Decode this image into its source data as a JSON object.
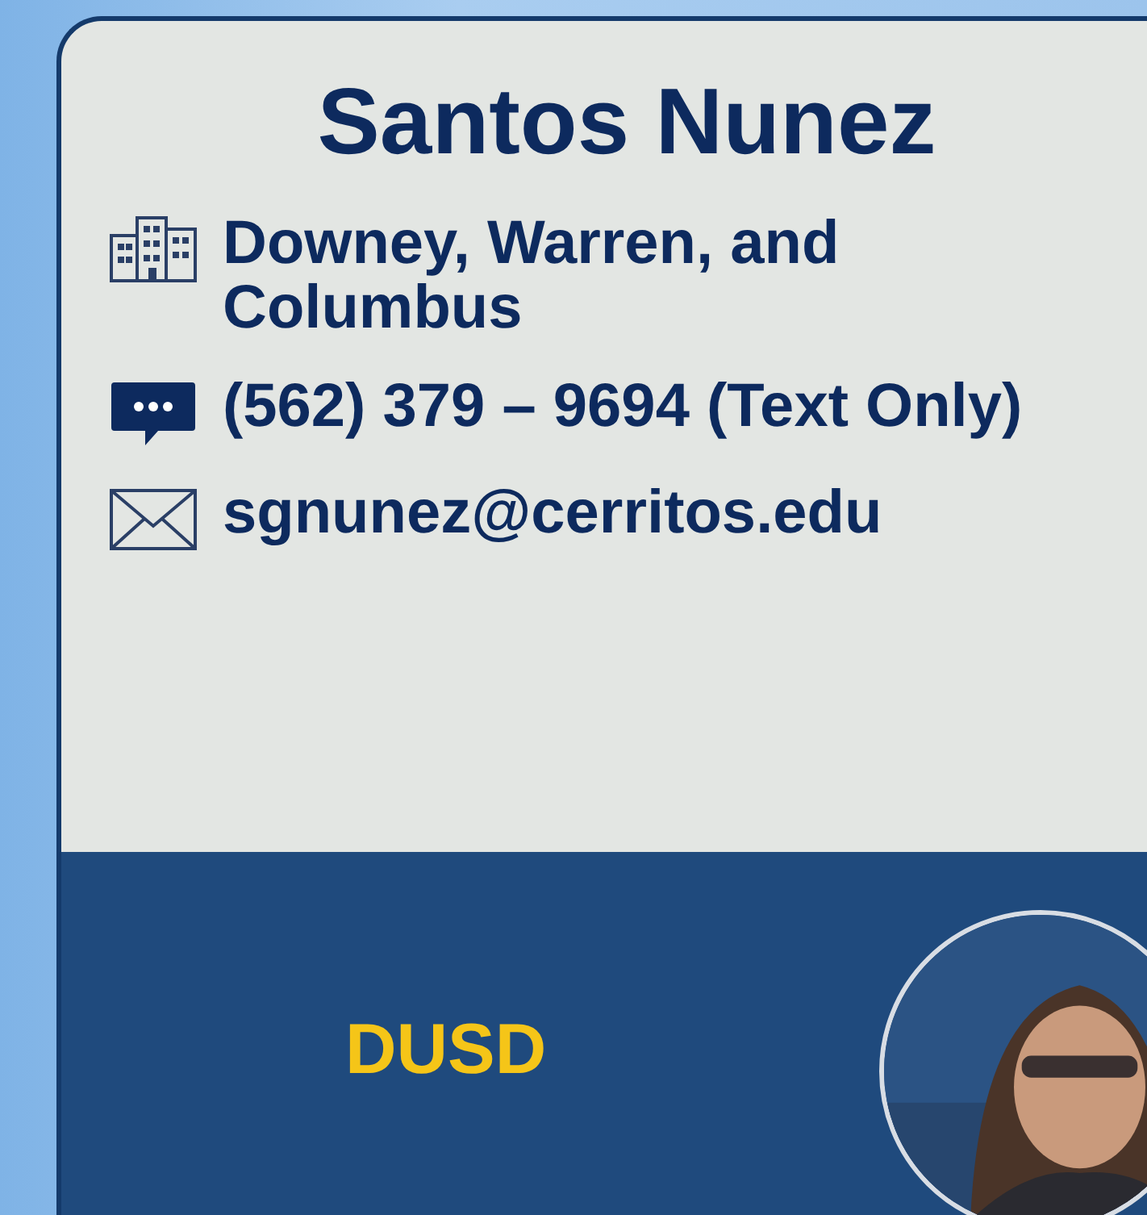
{
  "card": {
    "name": "Santos Nunez",
    "contacts": [
      {
        "kind": "location",
        "text": "Downey, Warren, and Columbus"
      },
      {
        "kind": "text-message",
        "text": "(562) 379 – 9694 (Text Only)"
      },
      {
        "kind": "email",
        "text": "sgnunez@cerritos.edu"
      }
    ],
    "district": "DUSD"
  }
}
